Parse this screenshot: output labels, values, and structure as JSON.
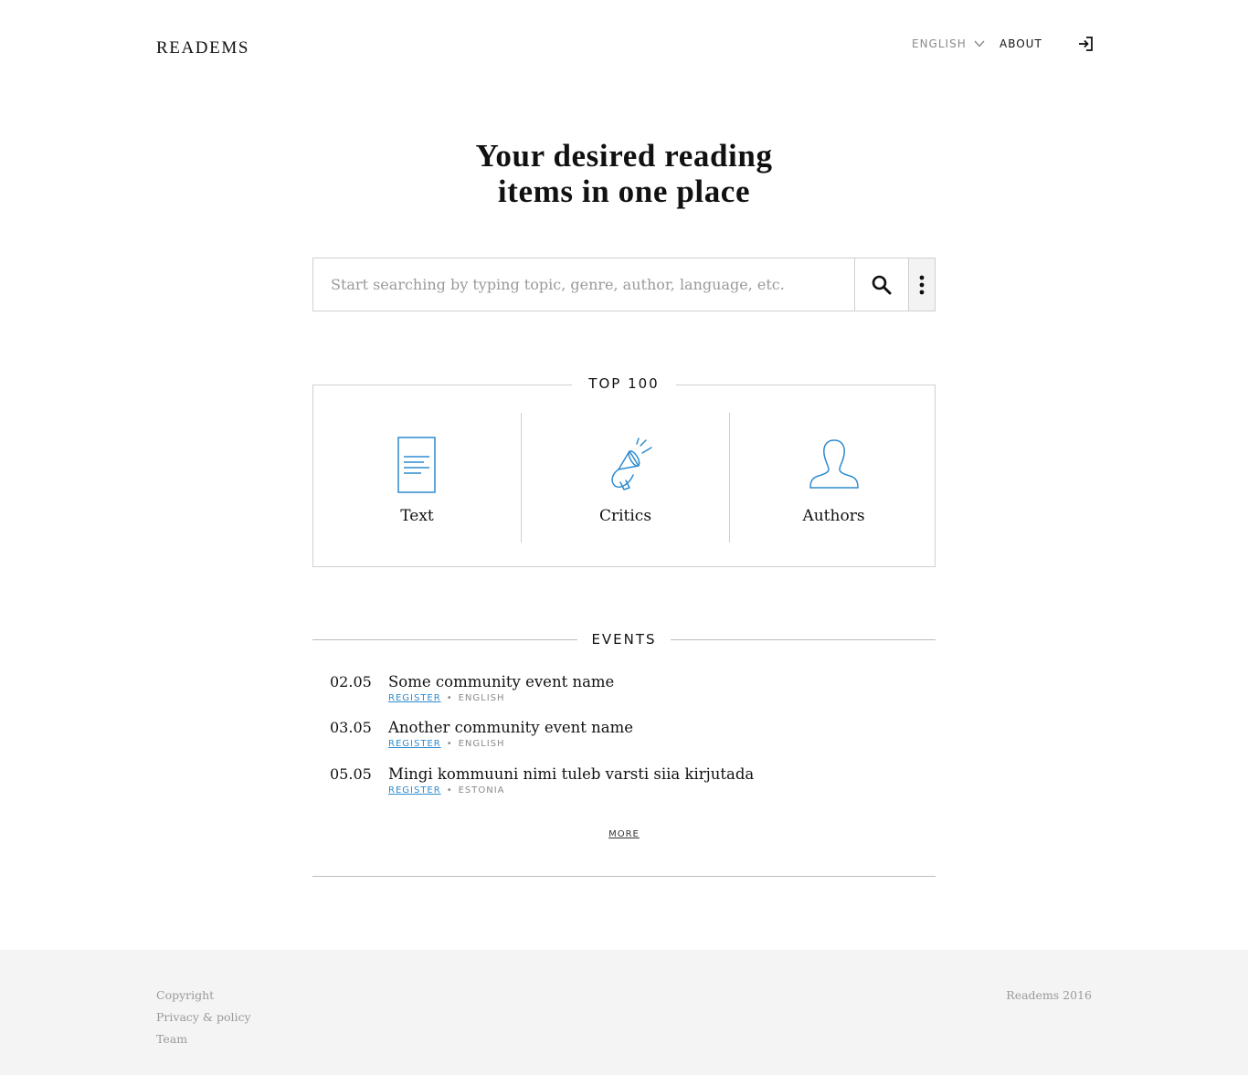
{
  "header": {
    "logo": "READEMS",
    "language": "ENGLISH",
    "about": "ABOUT"
  },
  "hero": {
    "title_line1": "Your desired reading",
    "title_line2": "items in one place"
  },
  "search": {
    "placeholder": "Start searching by typing topic, genre, author, language, etc."
  },
  "top100": {
    "title": "TOP 100",
    "items": [
      {
        "label": "Text",
        "icon": "document-icon"
      },
      {
        "label": "Critics",
        "icon": "megaphone-icon"
      },
      {
        "label": "Authors",
        "icon": "person-icon"
      }
    ]
  },
  "events": {
    "title": "EVENTS",
    "items": [
      {
        "date": "02.05",
        "name": "Some community event name",
        "register": "REGISTER",
        "language": "ENGLISH"
      },
      {
        "date": "03.05",
        "name": "Another community event name",
        "register": "REGISTER",
        "language": "ENGLISH"
      },
      {
        "date": "05.05",
        "name": "Mingi kommuuni nimi tuleb varsti siia kirjutada",
        "register": "REGISTER",
        "language": "ESTONIA"
      }
    ],
    "more": "MORE"
  },
  "footer": {
    "links": [
      "Copyright",
      "Privacy & policy",
      "Team"
    ],
    "copyright": "Readems 2016"
  },
  "colors": {
    "accent": "#2e8bcf",
    "border": "#cfcfcf",
    "footer_bg": "#f4f4f4",
    "muted": "#9a9a9a"
  }
}
